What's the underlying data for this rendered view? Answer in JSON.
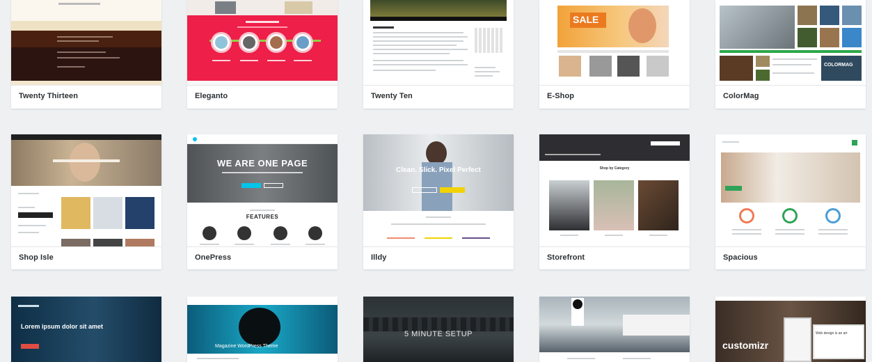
{
  "themes_row1": [
    {
      "name": "Twenty Thirteen"
    },
    {
      "name": "Eleganto"
    },
    {
      "name": "Twenty Ten"
    },
    {
      "name": "E-Shop"
    },
    {
      "name": "ColorMag"
    }
  ],
  "themes_row2": [
    {
      "name": "Shop Isle"
    },
    {
      "name": "OnePress"
    },
    {
      "name": "Illdy"
    },
    {
      "name": "Storefront"
    },
    {
      "name": "Spacious"
    }
  ],
  "previews": {
    "eshop_sale": "SALE",
    "colormag_logo": "COLORMAG",
    "onepress_hero": "WE ARE ONE PAGE",
    "onepress_features": "FEATURES",
    "illdy_hero": "Clean. Slick. Pixel Perfect",
    "storefront_heading": "Shop by Category",
    "row3_1_hero": "Lorem ipsum dolor sit amet",
    "row3_2_hero": "Magazine WordPress Theme",
    "row3_3_hero": "5 MINUTE SETUP",
    "row3_5_logo": "customizr",
    "row3_5_tag": "Web design is an art"
  }
}
